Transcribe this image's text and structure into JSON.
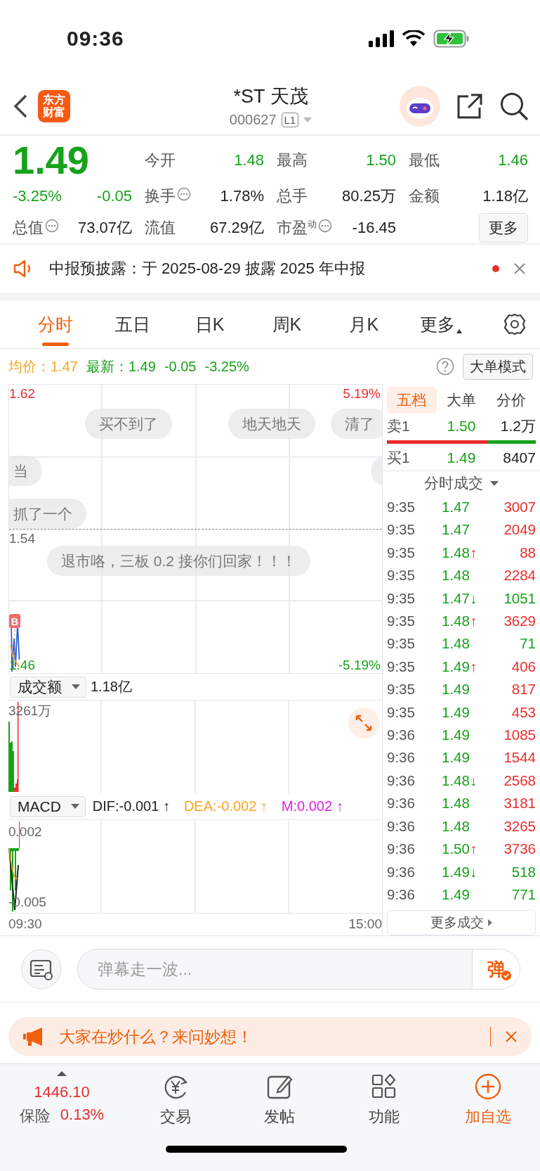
{
  "status_bar": {
    "time": "09:36"
  },
  "header": {
    "logo_lines": [
      "东方",
      "财富"
    ],
    "title": "*ST 天茂",
    "code": "000627",
    "level_badge": "L1"
  },
  "quote": {
    "price": "1.49",
    "change_pct": "-3.25%",
    "change": "-0.05",
    "stats": [
      {
        "label": "今开",
        "value": "1.48",
        "info": false,
        "color": "#16a21a"
      },
      {
        "label": "最高",
        "value": "1.50",
        "info": false,
        "color": "#16a21a"
      },
      {
        "label": "最低",
        "value": "1.46",
        "info": false,
        "color": "#16a21a"
      },
      {
        "label": "换手",
        "value": "1.78%",
        "info": true,
        "color": "#222222"
      },
      {
        "label": "总手",
        "value": "80.25万",
        "info": false,
        "color": "#222222"
      },
      {
        "label": "金额",
        "value": "1.18亿",
        "info": false,
        "color": "#222222"
      },
      {
        "label": "总值",
        "value": "73.07亿",
        "info": true,
        "color": "#222222"
      },
      {
        "label": "流值",
        "value": "67.29亿",
        "info": false,
        "color": "#222222"
      },
      {
        "label": "市盈$^{动}$",
        "value": "-16.45",
        "info": true,
        "color": "#222222"
      }
    ],
    "more_button": "更多"
  },
  "notice": {
    "text": "中报预披露：于 2025-08-29 披露 2025 年中报",
    "unread": true
  },
  "tabs": [
    {
      "label": "分时",
      "selected": true
    },
    {
      "label": "五日",
      "selected": false
    },
    {
      "label": "日K",
      "selected": false
    },
    {
      "label": "周K",
      "selected": false
    },
    {
      "label": "月K",
      "selected": false
    },
    {
      "label": "更多",
      "selected": false,
      "dropdown": true
    }
  ],
  "info_line": {
    "avg_label": "均价：",
    "avg": "1.47",
    "latest_label": "最新：",
    "latest": "1.49",
    "change": "-0.05",
    "change_pct": "-3.25%",
    "mode_button": "大单模式"
  },
  "price_chart": {
    "high": "1.62",
    "prev_close": "1.54",
    "low": "1.46",
    "high_pct": "5.19%",
    "low_pct": "-5.19%",
    "trade_marker": "B",
    "comments": [
      {
        "text": "买不到了"
      },
      {
        "text": "地天地天"
      },
      {
        "text": "清了"
      },
      {
        "text": "当"
      },
      {
        "text": "抓了一个"
      },
      {
        "text": "退市咯，三板 0.2 接你们回家！！！"
      }
    ]
  },
  "volume_panel": {
    "selector": "成交额",
    "total": "1.18亿",
    "max_label": "3261万"
  },
  "macd_panel": {
    "selector": "MACD",
    "dif": "DIF:-0.001 ↑",
    "dea": "DEA:-0.002 ↑",
    "m": "M:0.002 ↑",
    "max_label": "0.002",
    "min_label": "-0.005"
  },
  "time_axis": {
    "start": "09:30",
    "end": "15:00"
  },
  "side_tabs": [
    {
      "label": "五档",
      "selected": true
    },
    {
      "label": "大单",
      "selected": false
    },
    {
      "label": "分价",
      "selected": false
    }
  ],
  "order_book": {
    "ask": {
      "label": "卖1",
      "price": "1.50",
      "volume": "1.2万"
    },
    "level": 0.68,
    "bid": {
      "label": "买1",
      "price": "1.49",
      "volume": "8407"
    }
  },
  "trades_header": "分时成交",
  "trades": [
    {
      "time": "9:35",
      "price": "1.47",
      "kind": "flat",
      "volume": "3007",
      "color": "#ea2d2d"
    },
    {
      "time": "9:35",
      "price": "1.47",
      "kind": "flat",
      "volume": "2049",
      "color": "#ea2d2d"
    },
    {
      "time": "9:35",
      "price": "1.48",
      "kind": "up",
      "arrow": "↑",
      "volume": "88",
      "color": "#ea2d2d"
    },
    {
      "time": "9:35",
      "price": "1.48",
      "kind": "flat",
      "volume": "2284",
      "color": "#ea2d2d"
    },
    {
      "time": "9:35",
      "price": "1.47",
      "kind": "down",
      "arrow": "↓",
      "volume": "1051",
      "color": "#16a21a"
    },
    {
      "time": "9:35",
      "price": "1.48",
      "kind": "up",
      "arrow": "↑",
      "volume": "3629",
      "color": "#ea2d2d"
    },
    {
      "time": "9:35",
      "price": "1.48",
      "kind": "flat",
      "volume": "71",
      "color": "#16a21a"
    },
    {
      "time": "9:35",
      "price": "1.49",
      "kind": "up",
      "arrow": "↑",
      "volume": "406",
      "color": "#ea2d2d"
    },
    {
      "time": "9:35",
      "price": "1.49",
      "kind": "flat",
      "volume": "817",
      "color": "#ea2d2d"
    },
    {
      "time": "9:35",
      "price": "1.49",
      "kind": "flat",
      "volume": "453",
      "color": "#ea2d2d"
    },
    {
      "time": "9:36",
      "price": "1.49",
      "kind": "flat",
      "volume": "1085",
      "color": "#ea2d2d"
    },
    {
      "time": "9:36",
      "price": "1.49",
      "kind": "flat",
      "volume": "1544",
      "color": "#ea2d2d"
    },
    {
      "time": "9:36",
      "price": "1.48",
      "kind": "down",
      "arrow": "↓",
      "volume": "2568",
      "color": "#ea2d2d"
    },
    {
      "time": "9:36",
      "price": "1.48",
      "kind": "flat",
      "volume": "3181",
      "color": "#ea2d2d"
    },
    {
      "time": "9:36",
      "price": "1.48",
      "kind": "flat",
      "volume": "3265",
      "color": "#ea2d2d"
    },
    {
      "time": "9:36",
      "price": "1.50",
      "kind": "up",
      "arrow": "↑",
      "volume": "3736",
      "color": "#ea2d2d"
    },
    {
      "time": "9:36",
      "price": "1.49",
      "kind": "down",
      "arrow": "↓",
      "volume": "518",
      "color": "#16a21a"
    },
    {
      "time": "9:36",
      "price": "1.49",
      "kind": "flat",
      "volume": "771",
      "color": "#16a21a"
    }
  ],
  "more_trades": "更多成交",
  "comment_bar": {
    "placeholder": "弹幕走一波...",
    "send_button": "弹"
  },
  "promo_banner": {
    "text": "大家在炒什么？来问妙想！"
  },
  "bottom_nav": {
    "index_value": "1446.10",
    "index_label": "保险",
    "index_change": "0.13%",
    "items": [
      {
        "kind": "trade",
        "label": "交易",
        "accent": false
      },
      {
        "kind": "post",
        "label": "发帖",
        "accent": false
      },
      {
        "kind": "functions",
        "label": "功能",
        "accent": false
      },
      {
        "kind": "add",
        "label": "加自选",
        "accent": true
      }
    ]
  }
}
